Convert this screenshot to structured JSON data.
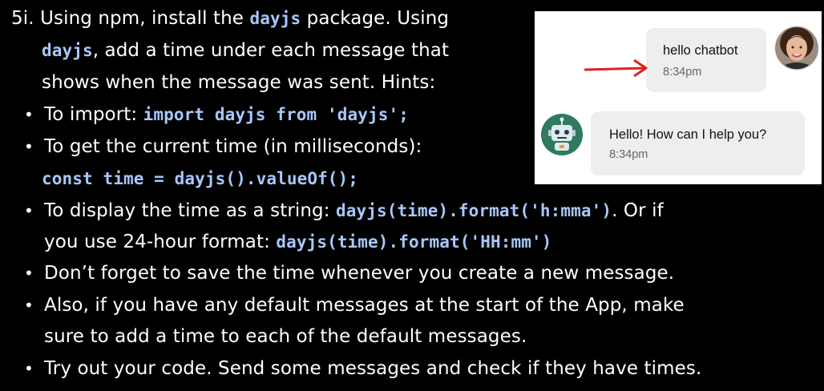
{
  "instructions": {
    "heading": {
      "number": "5i.",
      "part1": "Using npm, install the ",
      "code1": "dayjs",
      "part2": " package. Using",
      "code2": "dayjs",
      "part3": ", add a time under each message that",
      "part4": "shows when the message was sent. Hints:"
    },
    "bullets": [
      {
        "text": "To import: ",
        "code": "import dayjs from 'dayjs';"
      },
      {
        "text": "To get the current time (in milliseconds):",
        "code": "const time = dayjs().valueOf();"
      },
      {
        "text": "To display the time as a string: ",
        "code": "dayjs(time).format('h:mma')",
        "text2": ". Or if",
        "text3": "you use 24-hour format: ",
        "code2": "dayjs(time).format('HH:mm')"
      },
      {
        "text": "Don’t forget to save the time whenever you create a new message."
      },
      {
        "text": "Also, if you have any default messages at the start of the App, make",
        "text2": "sure to add a time to each of the default messages."
      },
      {
        "text": "Try out your code. Send some messages and check if they have times."
      }
    ],
    "bullet_char": "•"
  },
  "chat_preview": {
    "messages": [
      {
        "sender": "user",
        "text": "hello chatbot",
        "time": "8:34pm"
      },
      {
        "sender": "robot",
        "text": "Hello! How can I help you?",
        "time": "8:34pm"
      }
    ],
    "colors": {
      "arrow": "#e02020",
      "robot_bg": "#2f7a5c",
      "bubble_bg": "#eeeeee",
      "code_text": "#a8c7fa"
    },
    "icons": [
      "user-avatar-icon",
      "robot-avatar-icon",
      "red-arrow-icon"
    ]
  }
}
